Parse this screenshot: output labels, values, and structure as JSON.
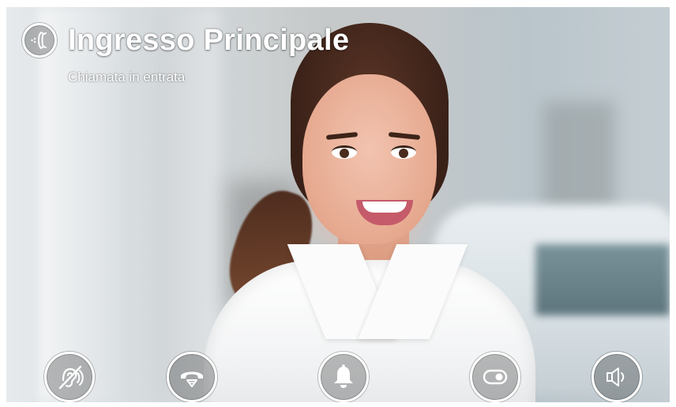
{
  "header": {
    "title": "Ingresso Principale",
    "subtitle": "Chiamata in entrata",
    "door_icon": "doorbell-intercom-icon"
  },
  "controls": [
    {
      "name": "mute-audio-button",
      "icon": "ear-mute-icon"
    },
    {
      "name": "answer-call-button",
      "icon": "handset-icon"
    },
    {
      "name": "bell-button",
      "icon": "bell-icon"
    },
    {
      "name": "toggle-button",
      "icon": "toggle-icon"
    },
    {
      "name": "volume-button",
      "icon": "speaker-icon"
    }
  ],
  "colors": {
    "overlay_text": "#ffffff",
    "button_ring": "#ffffff"
  }
}
